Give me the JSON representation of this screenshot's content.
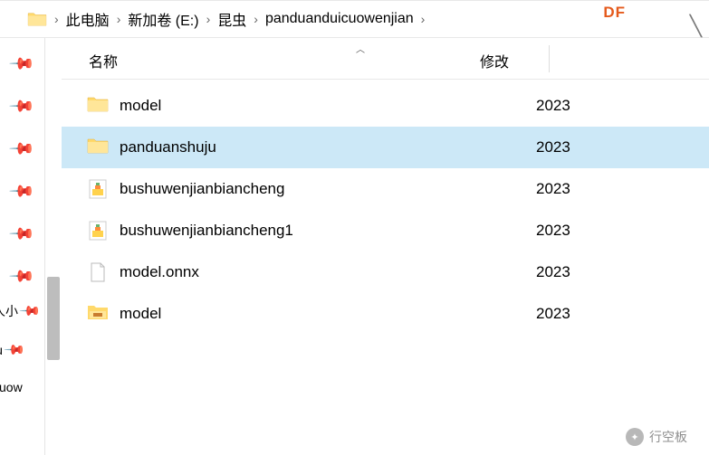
{
  "badge": "DF",
  "breadcrumb": {
    "items": [
      "此电脑",
      "新加卷 (E:)",
      "昆虫",
      "panduanduicuowenjian"
    ]
  },
  "columns": {
    "name": "名称",
    "modified": "修改"
  },
  "left_items": [
    "人小",
    "ju",
    "cuow"
  ],
  "files": [
    {
      "name": "model",
      "date": "2023",
      "type": "folder",
      "selected": false
    },
    {
      "name": "panduanshuju",
      "date": "2023",
      "type": "folder",
      "selected": true
    },
    {
      "name": "bushuwenjianbiancheng",
      "date": "2023",
      "type": "mind",
      "selected": false
    },
    {
      "name": "bushuwenjianbiancheng1",
      "date": "2023",
      "type": "mind",
      "selected": false
    },
    {
      "name": "model.onnx",
      "date": "2023",
      "type": "file",
      "selected": false
    },
    {
      "name": "model",
      "date": "2023",
      "type": "package",
      "selected": false
    }
  ],
  "watermark": "行空板"
}
